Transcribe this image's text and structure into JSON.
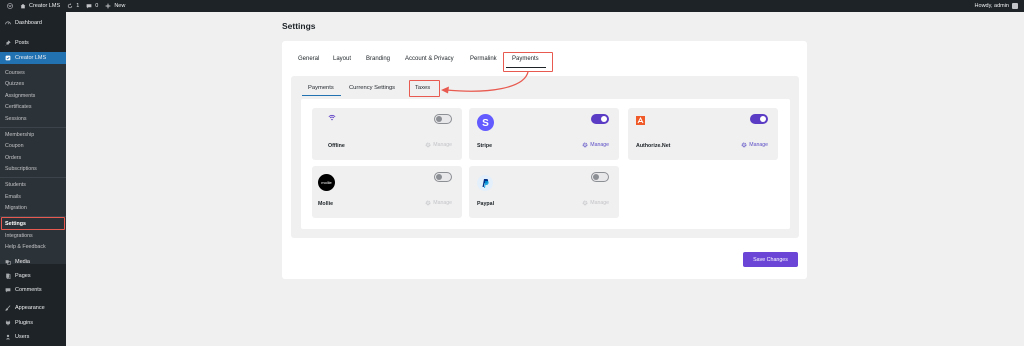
{
  "admin_bar": {
    "site_name": "Creator LMS",
    "updates_count": "1",
    "comments_count": "0",
    "new_label": "New",
    "greeting": "Howdy, admin"
  },
  "sidebar": {
    "dashboard": "Dashboard",
    "posts": "Posts",
    "creator_lms": "Creator LMS",
    "submenu": [
      "Courses",
      "Quizzes",
      "Assignments",
      "Certificates",
      "Sessions",
      "Membership",
      "Coupon",
      "Orders",
      "Subscriptions",
      "Students",
      "Emails",
      "Migration",
      "Settings",
      "Integrations",
      "Help & Feedback"
    ],
    "media": "Media",
    "pages": "Pages",
    "comments": "Comments",
    "appearance": "Appearance",
    "plugins": "Plugins",
    "users": "Users"
  },
  "page_title": "Settings",
  "tabs": [
    "General",
    "Layout",
    "Branding",
    "Account & Privacy",
    "Permalink",
    "Payments"
  ],
  "subtabs": [
    "Payments",
    "Currency Settings",
    "Taxes"
  ],
  "gateways": [
    {
      "name": "Offline",
      "manage": "Manage",
      "enabled": false,
      "icon": "wifi-icon"
    },
    {
      "name": "Stripe",
      "manage": "Manage",
      "enabled": true,
      "icon": "stripe-logo"
    },
    {
      "name": "Authorize.Net",
      "manage": "Manage",
      "enabled": true,
      "icon": "authorize-net-logo"
    },
    {
      "name": "Mollie",
      "manage": "Manage",
      "enabled": false,
      "icon": "mollie-logo",
      "logo_text": "mollie"
    },
    {
      "name": "Paypal",
      "manage": "Manage",
      "enabled": false,
      "icon": "paypal-logo"
    }
  ],
  "save_label": "Save Changes",
  "colors": {
    "accent": "#6b46d6",
    "highlight": "#e85a4f",
    "wp_blue": "#2271b1"
  }
}
